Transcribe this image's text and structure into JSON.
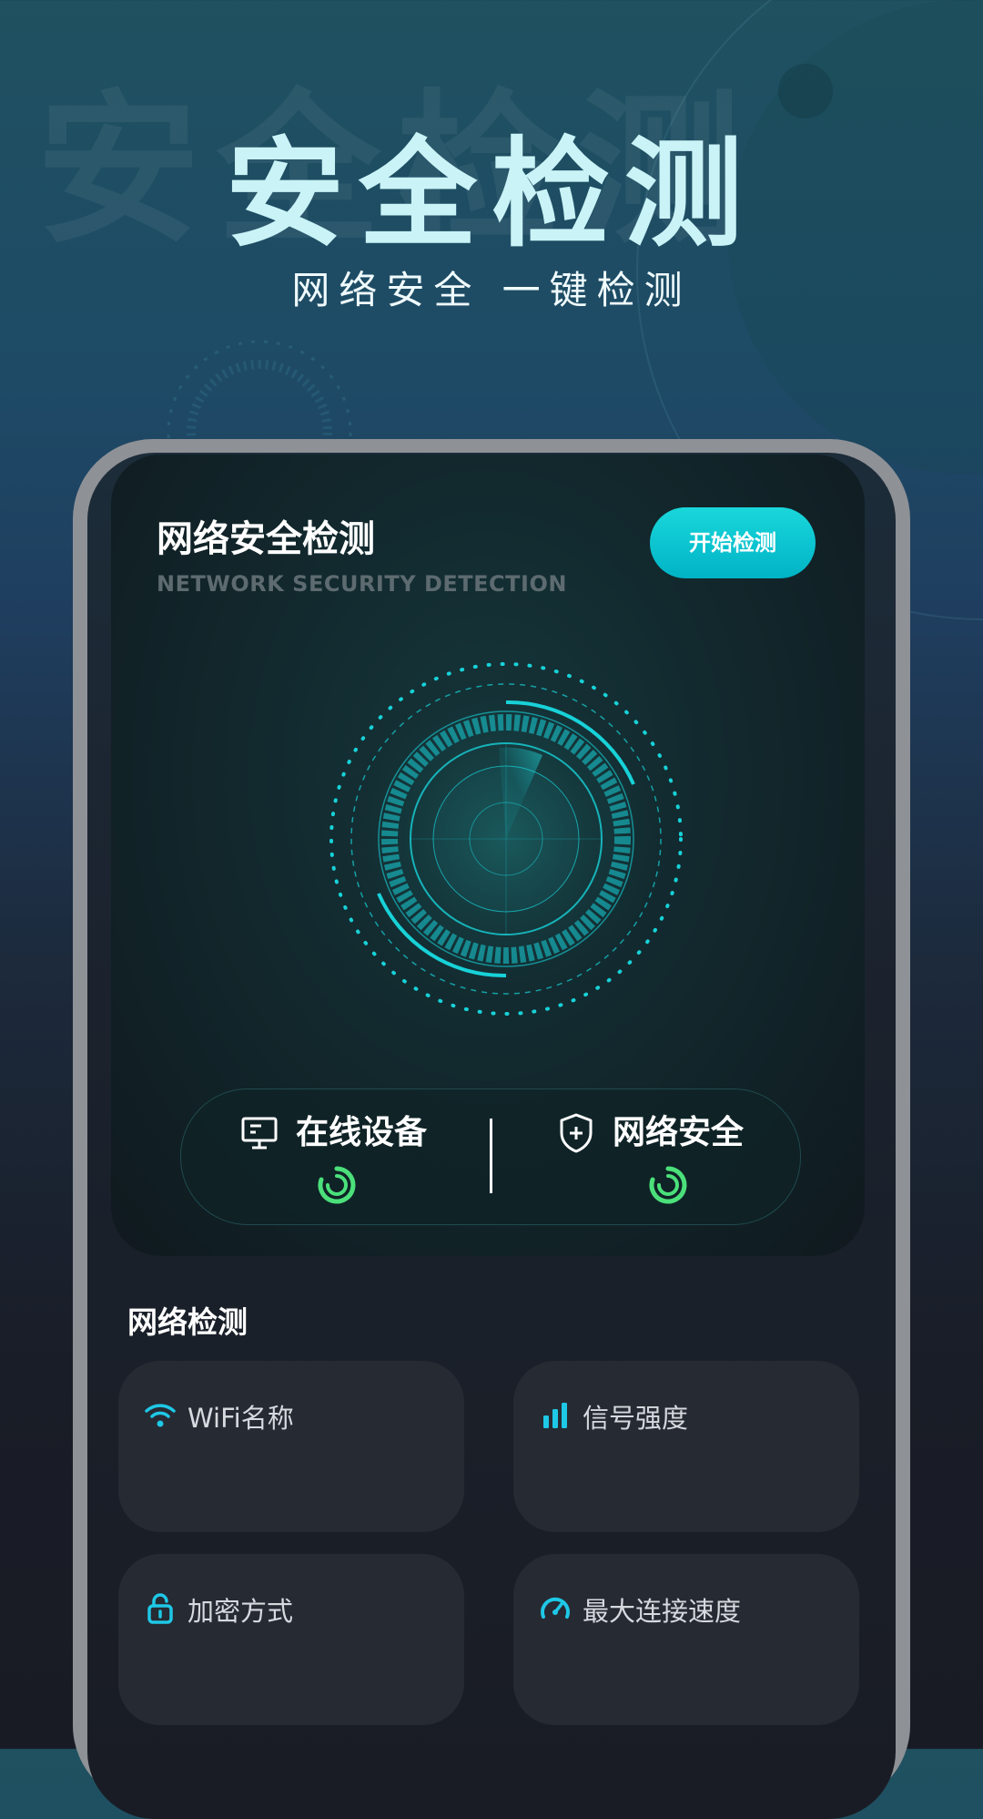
{
  "hero": {
    "watermark": "安全检测",
    "title": "安全检测",
    "subtitle": "网络安全  一键检测"
  },
  "card": {
    "title": "网络安全检测",
    "subtitle": "NETWORK SECURITY DETECTION",
    "start_button": "开始检测"
  },
  "status": {
    "devices_label": "在线设备",
    "security_label": "网络安全"
  },
  "section": {
    "title": "网络检测"
  },
  "metrics": [
    {
      "label": "WiFi名称",
      "icon": "wifi-icon"
    },
    {
      "label": "信号强度",
      "icon": "signal-bars-icon"
    },
    {
      "label": "加密方式",
      "icon": "unlock-icon"
    },
    {
      "label": "最大连接速度",
      "icon": "speedometer-icon"
    }
  ],
  "colors": {
    "accent": "#17d2d8",
    "status_green": "#4be07a",
    "icon_blue": "#1ec8e6"
  }
}
